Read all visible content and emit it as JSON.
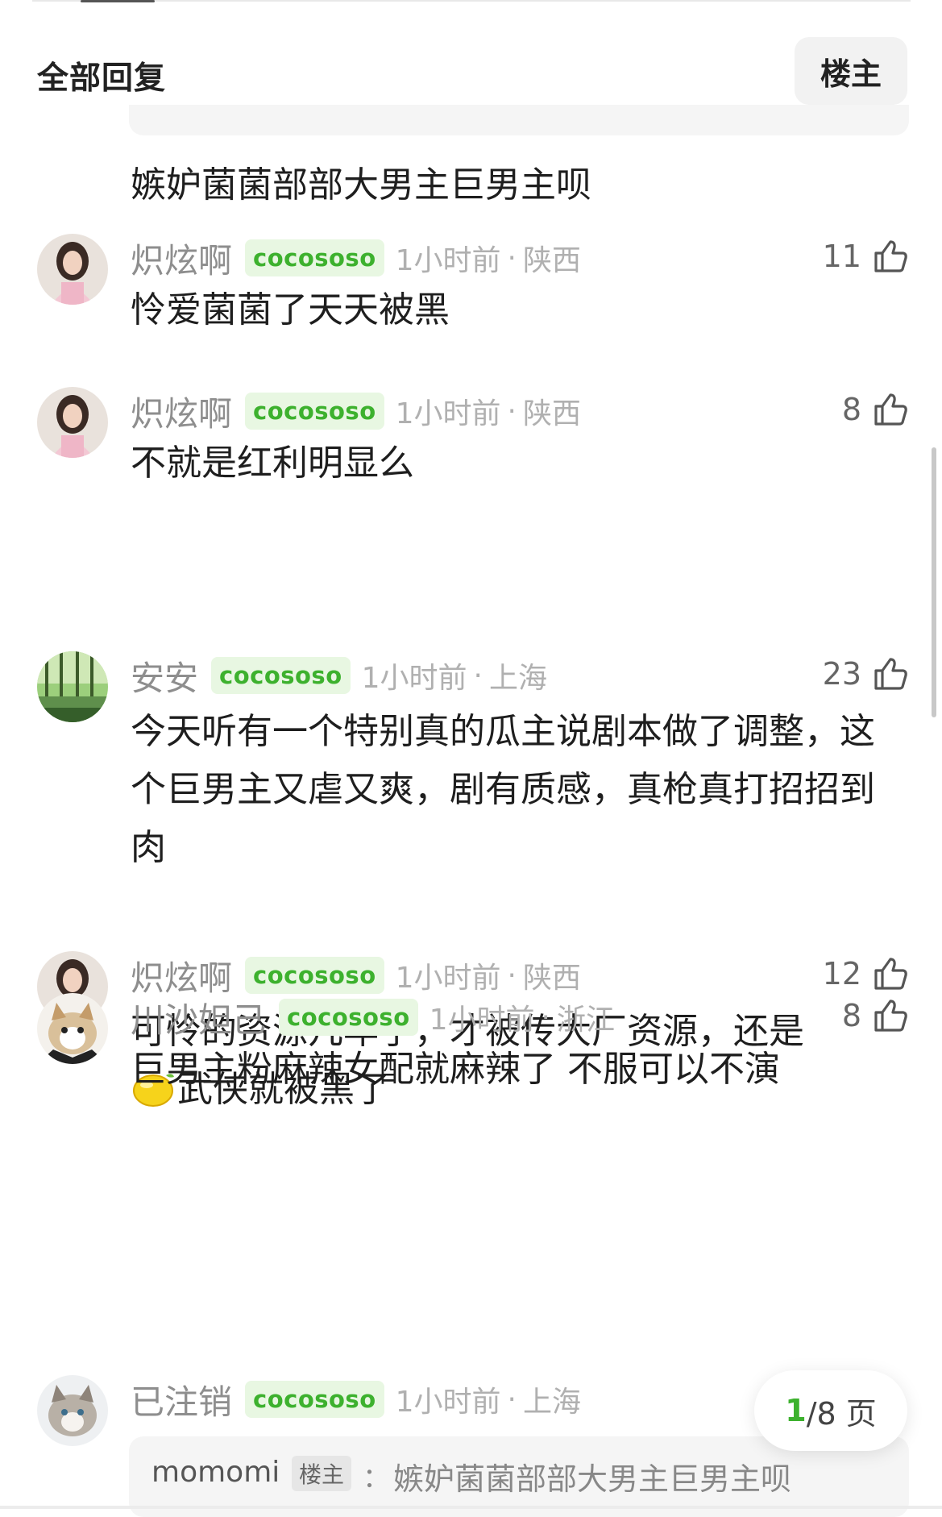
{
  "header": {
    "title": "全部回复",
    "op_filter_label": "楼主"
  },
  "previous_comment": {
    "text": "嫉妒菌菌部部大男主巨男主呗"
  },
  "replies": [
    {
      "username": "炽炫啊",
      "tag": "cocososo",
      "time": "1小时前",
      "separator": "·",
      "location": "陕西",
      "likes": "11",
      "text": "怜爱菌菌了天天被黑",
      "avatar": "girl-avatar"
    },
    {
      "username": "炽炫啊",
      "tag": "cocososo",
      "time": "1小时前",
      "separator": "·",
      "location": "陕西",
      "likes": "8",
      "text": "不就是红利明显么",
      "avatar": "girl-avatar"
    },
    {
      "username": "安安",
      "tag": "cocososo",
      "time": "1小时前",
      "separator": "·",
      "location": "上海",
      "likes": "23",
      "text": "今天听有一个特别真的瓜主说剧本做了调整，这个巨男主又虐又爽，剧有质感，真枪真打招招到肉",
      "avatar": "forest-avatar"
    },
    {
      "username": "炽炫啊",
      "tag": "cocososo",
      "time": "1小时前",
      "separator": "·",
      "location": "陕西",
      "likes": "12",
      "text_before": "可怜的资源几年了，才被传大厂资源，还是",
      "text_after": "武侠就被黑了",
      "emoji": "lemon-emoji",
      "avatar": "girl-avatar"
    },
    {
      "username": "川沙妲己",
      "tag": "cocososo",
      "time": "1小时前",
      "separator": "·",
      "location": "浙江",
      "likes": "8",
      "text": "巨男主粉麻辣女配就麻辣了 不服可以不演",
      "avatar": "cat-avatar"
    },
    {
      "username": "已注销",
      "tag": "cocososo",
      "time": "1小时前",
      "separator": "·",
      "location": "上海",
      "avatar": "cat-avatar",
      "quote": {
        "user": "momomi",
        "badge": "楼主",
        "colon": "：",
        "text": "嫉妒菌菌部部大男主巨男主呗"
      }
    }
  ],
  "pagination": {
    "current": "1",
    "total_text": "/8 页"
  },
  "icons": {
    "like": "thumbs-up-icon"
  },
  "colors": {
    "tag_text": "#3db12e",
    "tag_bg": "#e8f7e2",
    "meta_gray": "#b0b0b0"
  }
}
